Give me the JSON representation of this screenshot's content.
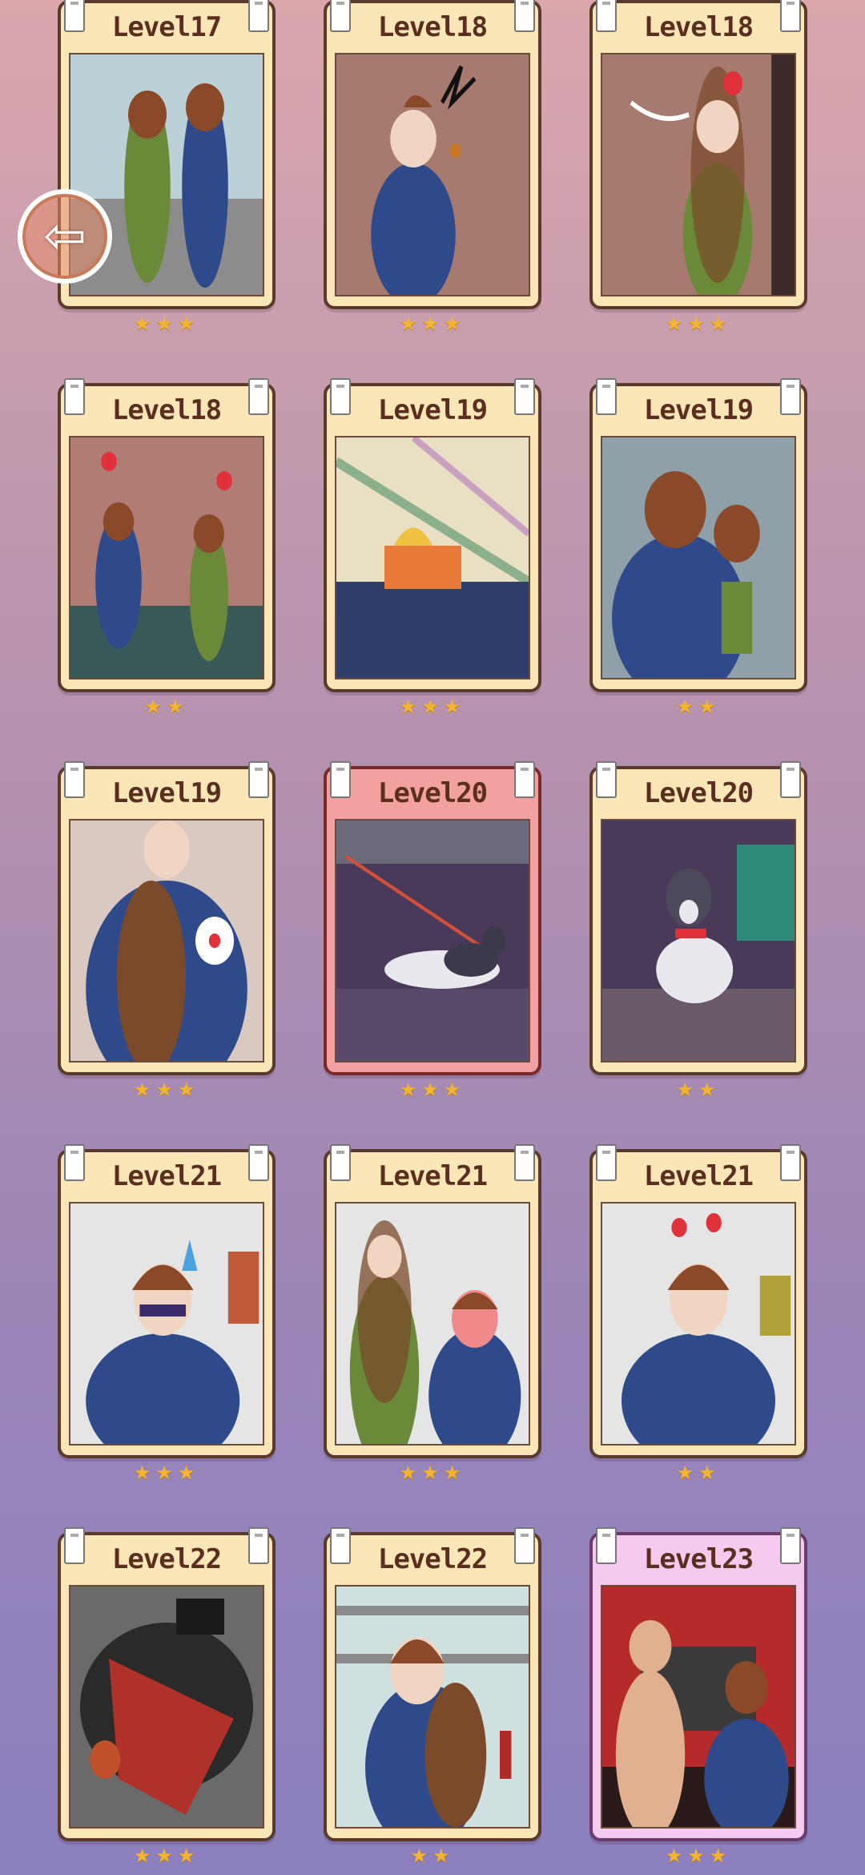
{
  "back_button": {
    "icon": "arrow-left-icon",
    "glyph": "⇦"
  },
  "levels": [
    {
      "label": "Level17",
      "stars": "★★★",
      "color": "#bcd0d8",
      "frame": "normal"
    },
    {
      "label": "Level18",
      "stars": "★★★",
      "color": "#a77a6f",
      "frame": "normal"
    },
    {
      "label": "Level18",
      "stars": "★★★",
      "color": "#a77a6f",
      "frame": "normal"
    },
    {
      "label": "Level18",
      "stars": "★★",
      "color": "#b07c74",
      "frame": "normal"
    },
    {
      "label": "Level19",
      "stars": "★★★",
      "color": "#e9dfc2",
      "frame": "normal"
    },
    {
      "label": "Level19",
      "stars": "★★",
      "color": "#8fa0a8",
      "frame": "normal"
    },
    {
      "label": "Level19",
      "stars": "★★★",
      "color": "#d9c9c0",
      "frame": "normal"
    },
    {
      "label": "Level20",
      "stars": "★★★",
      "color": "#4a3a5a",
      "frame": "red"
    },
    {
      "label": "Level20",
      "stars": "★★",
      "color": "#4a3a5a",
      "frame": "normal"
    },
    {
      "label": "Level21",
      "stars": "★★★",
      "color": "#e5e5e5",
      "frame": "normal"
    },
    {
      "label": "Level21",
      "stars": "★★★",
      "color": "#e5e5e5",
      "frame": "normal"
    },
    {
      "label": "Level21",
      "stars": "★★",
      "color": "#e5e5e5",
      "frame": "normal"
    },
    {
      "label": "Level22",
      "stars": "★★★",
      "color": "#6a6a6a",
      "frame": "normal"
    },
    {
      "label": "Level22",
      "stars": "★★",
      "color": "#cfe0e0",
      "frame": "normal"
    },
    {
      "label": "Level23",
      "stars": "★★★",
      "color": "#b52a2a",
      "frame": "pink"
    }
  ]
}
